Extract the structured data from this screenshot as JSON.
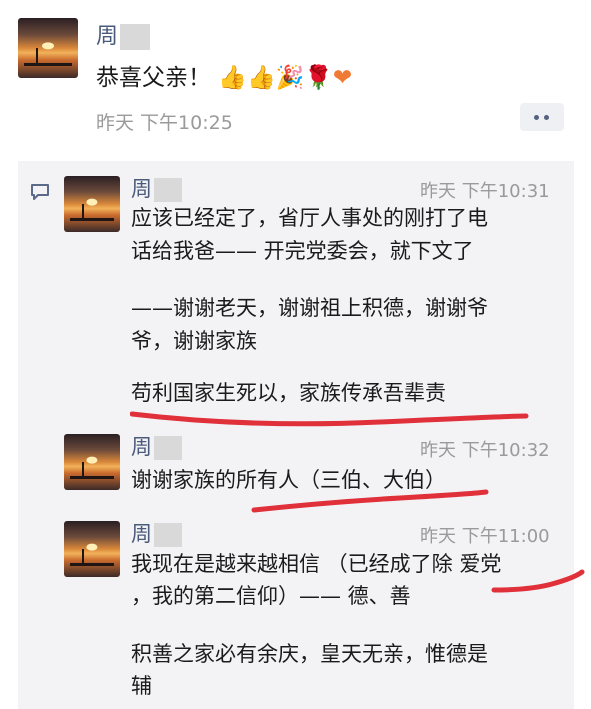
{
  "post": {
    "author": "周",
    "text": "恭喜父亲！",
    "emojis": [
      "thumbs-up-icon",
      "thumbs-up-icon",
      "party-popper-icon",
      "rose-icon",
      "heart-icon"
    ],
    "time": "昨天 下午10:25"
  },
  "comments": [
    {
      "author": "周",
      "time": "昨天 下午10:31",
      "lines": [
        "应该已经定了，省厅人事处的刚打了电",
        "话给我爸—— 开完党委会，就下文了",
        "——谢谢老天，谢谢祖上积德，谢谢爷",
        "爷，谢谢家族",
        "苟利国家生死以，家族传承吾辈责"
      ]
    },
    {
      "author": "周",
      "time": "昨天 下午10:32",
      "lines": [
        "谢谢家族的所有人（三伯、大伯）"
      ]
    },
    {
      "author": "周",
      "time": "昨天 下午11:00",
      "lines": [
        "我现在是越来越相信 （已经成了除 爱党",
        "，我的第二信仰）—— 德、善",
        "积善之家必有余庆，皇天无亲，惟德是",
        "辅"
      ]
    }
  ],
  "colors": {
    "name": "#4a5a7a",
    "annotation": "#e0303a",
    "comment_bg": "#f3f3f5"
  }
}
